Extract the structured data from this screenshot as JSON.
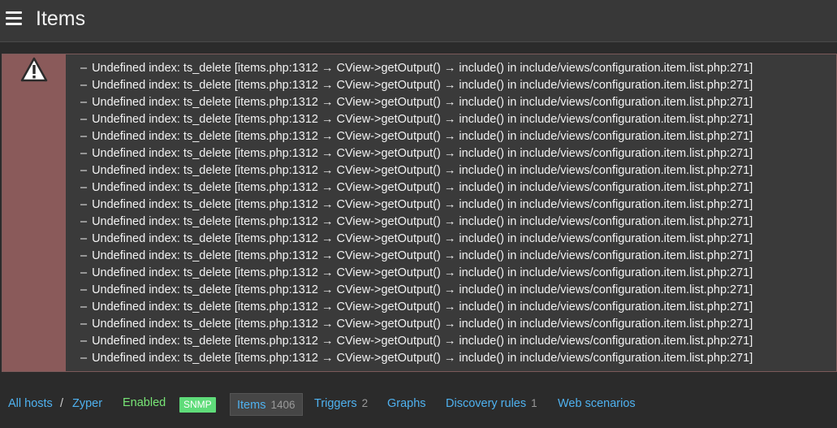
{
  "header": {
    "menu_icon": "hamburger-menu-icon",
    "title": "Items"
  },
  "error": {
    "icon": "warning-triangle-icon",
    "colors": {
      "sidebar": "#8a5a5a",
      "background": "#3a3a3a",
      "text": "#f2f2f2"
    },
    "messages": [
      "Undefined index: ts_delete [items.php:1312 → CView->getOutput() → include() in include/views/configuration.item.list.php:271]",
      "Undefined index: ts_delete [items.php:1312 → CView->getOutput() → include() in include/views/configuration.item.list.php:271]",
      "Undefined index: ts_delete [items.php:1312 → CView->getOutput() → include() in include/views/configuration.item.list.php:271]",
      "Undefined index: ts_delete [items.php:1312 → CView->getOutput() → include() in include/views/configuration.item.list.php:271]",
      "Undefined index: ts_delete [items.php:1312 → CView->getOutput() → include() in include/views/configuration.item.list.php:271]",
      "Undefined index: ts_delete [items.php:1312 → CView->getOutput() → include() in include/views/configuration.item.list.php:271]",
      "Undefined index: ts_delete [items.php:1312 → CView->getOutput() → include() in include/views/configuration.item.list.php:271]",
      "Undefined index: ts_delete [items.php:1312 → CView->getOutput() → include() in include/views/configuration.item.list.php:271]",
      "Undefined index: ts_delete [items.php:1312 → CView->getOutput() → include() in include/views/configuration.item.list.php:271]",
      "Undefined index: ts_delete [items.php:1312 → CView->getOutput() → include() in include/views/configuration.item.list.php:271]",
      "Undefined index: ts_delete [items.php:1312 → CView->getOutput() → include() in include/views/configuration.item.list.php:271]",
      "Undefined index: ts_delete [items.php:1312 → CView->getOutput() → include() in include/views/configuration.item.list.php:271]",
      "Undefined index: ts_delete [items.php:1312 → CView->getOutput() → include() in include/views/configuration.item.list.php:271]",
      "Undefined index: ts_delete [items.php:1312 → CView->getOutput() → include() in include/views/configuration.item.list.php:271]",
      "Undefined index: ts_delete [items.php:1312 → CView->getOutput() → include() in include/views/configuration.item.list.php:271]",
      "Undefined index: ts_delete [items.php:1312 → CView->getOutput() → include() in include/views/configuration.item.list.php:271]",
      "Undefined index: ts_delete [items.php:1312 → CView->getOutput() → include() in include/views/configuration.item.list.php:271]",
      "Undefined index: ts_delete [items.php:1312 → CView->getOutput() → include() in include/views/configuration.item.list.php:271]"
    ]
  },
  "nav": {
    "breadcrumb": {
      "all_hosts": "All hosts",
      "separator": "/",
      "host": "Zyper"
    },
    "status": "Enabled",
    "snmp_badge": "SNMP",
    "items": {
      "label": "Items",
      "count": "1406"
    },
    "triggers": {
      "label": "Triggers",
      "count": "2"
    },
    "graphs": {
      "label": "Graphs"
    },
    "discovery": {
      "label": "Discovery rules",
      "count": "1"
    },
    "web": {
      "label": "Web scenarios"
    },
    "colors": {
      "link": "#4fb2f0",
      "enabled": "#78e676",
      "snmp_bg": "#5fdc7a"
    }
  }
}
